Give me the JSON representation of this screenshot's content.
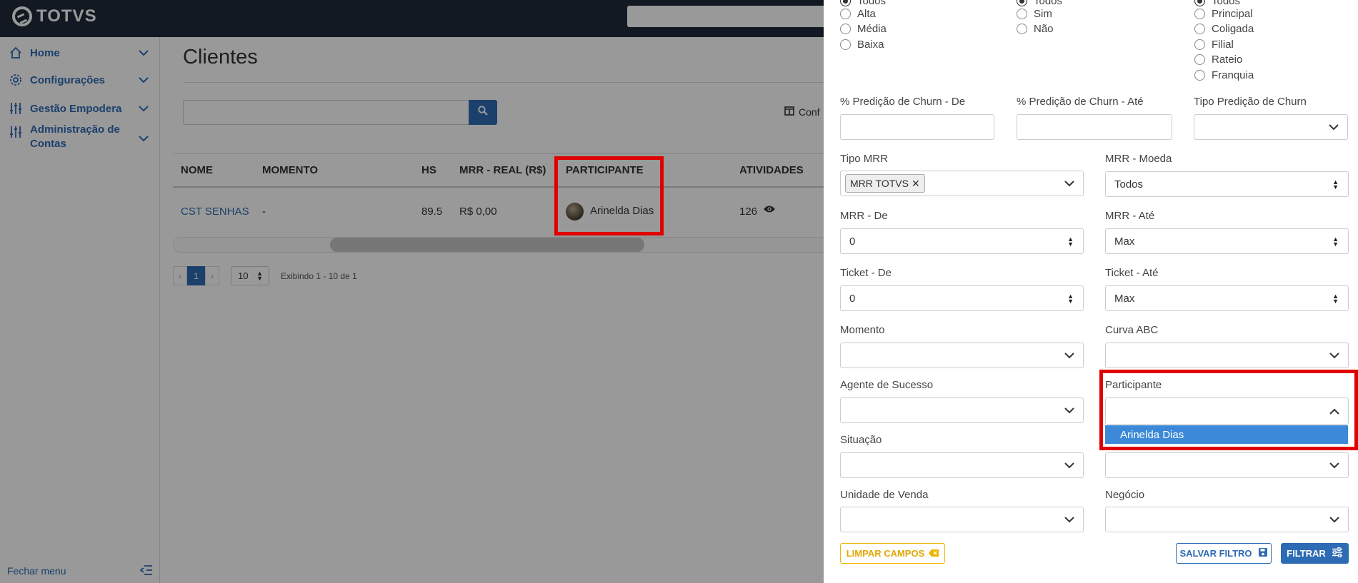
{
  "brand": {
    "name": "TOTVS"
  },
  "sidebar": {
    "items": [
      {
        "label": "Home",
        "icon": "home-icon"
      },
      {
        "label": "Configurações",
        "icon": "gear-icon"
      },
      {
        "label": "Gestão Empodera",
        "icon": "sliders-icon"
      },
      {
        "label": "Administração de Contas",
        "icon": "sliders-icon"
      }
    ],
    "footer_label": "Fechar menu"
  },
  "main": {
    "title": "Clientes",
    "config_label": "Conf",
    "table": {
      "columns": [
        "NOME",
        "MOMENTO",
        "HS",
        "MRR - REAL (R$)",
        "PARTICIPANTE",
        "ATIVIDADES"
      ],
      "rows": [
        {
          "nome": "CST SENHAS",
          "momento": "-",
          "hs": "89.5",
          "mrr": "R$ 0,00",
          "participante": "Arinelda Dias",
          "atividades": "126"
        }
      ]
    },
    "pagination": {
      "prev": "‹",
      "current": "1",
      "next": "›",
      "page_size": "10",
      "info": "Exibindo 1 - 10 de 1"
    }
  },
  "filters": {
    "radio_groups": [
      {
        "options": [
          {
            "label": "Todos",
            "checked": true
          },
          {
            "label": "Alta"
          },
          {
            "label": "Média"
          },
          {
            "label": "Baixa"
          }
        ]
      },
      {
        "options": [
          {
            "label": "Todos",
            "checked": true
          },
          {
            "label": "Sim"
          },
          {
            "label": "Não"
          }
        ]
      },
      {
        "options": [
          {
            "label": "Todos",
            "checked": true
          },
          {
            "label": "Principal"
          },
          {
            "label": "Coligada"
          },
          {
            "label": "Filial"
          },
          {
            "label": "Rateio"
          },
          {
            "label": "Franquia"
          }
        ]
      }
    ],
    "churn_de": {
      "label": "% Predição de Churn - De",
      "value": ""
    },
    "churn_ate": {
      "label": "% Predição de Churn - Até",
      "value": ""
    },
    "tipo_churn": {
      "label": "Tipo Predição de Churn",
      "value": ""
    },
    "tipo_mrr": {
      "label": "Tipo MRR",
      "tag": "MRR TOTVS"
    },
    "mrr_moeda": {
      "label": "MRR - Moeda",
      "value": "Todos"
    },
    "mrr_de": {
      "label": "MRR - De",
      "value": "0"
    },
    "mrr_ate": {
      "label": "MRR - Até",
      "value": "Max"
    },
    "ticket_de": {
      "label": "Ticket - De",
      "value": "0"
    },
    "ticket_ate": {
      "label": "Ticket - Até",
      "value": "Max"
    },
    "momento": {
      "label": "Momento",
      "value": ""
    },
    "curva_abc": {
      "label": "Curva ABC",
      "value": ""
    },
    "agente": {
      "label": "Agente de Sucesso",
      "value": ""
    },
    "participante": {
      "label": "Participante",
      "value": "",
      "option": "Arinelda Dias"
    },
    "situacao": {
      "label": "Situação",
      "value": ""
    },
    "unidade": {
      "label": "Unidade de Venda",
      "value": ""
    },
    "negocio": {
      "label": "Negócio",
      "value": ""
    },
    "buttons": {
      "clear": "LIMPAR CAMPOS",
      "save": "SALVAR FILTRO",
      "filter": "FILTRAR"
    }
  },
  "colors": {
    "primary": "#2e6bb5",
    "topbar": "#1f2a3a",
    "highlight": "#e00000",
    "warning": "#f0b400"
  }
}
